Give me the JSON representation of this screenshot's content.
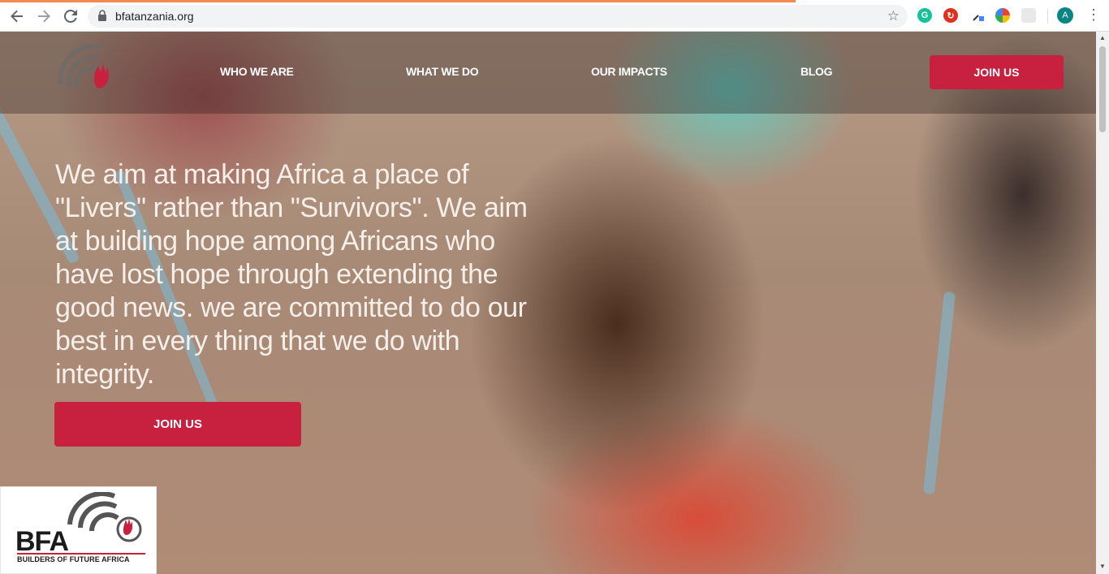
{
  "browser": {
    "url": "bfatanzania.org",
    "profile_initial": "A",
    "icons": [
      "back-icon",
      "forward-icon",
      "reload-icon",
      "lock-icon",
      "star-icon",
      "grammarly-icon",
      "extension-red-icon",
      "eyedropper-icon",
      "extension-chrome-icon",
      "extension-gray-icon",
      "more-vert-icon"
    ]
  },
  "site": {
    "nav": {
      "who_we_are": "WHO WE ARE",
      "what_we_do": "WHAT WE DO",
      "our_impacts": "OUR IMPACTS",
      "blog": "BLOG",
      "join_us": "JOIN US"
    },
    "hero": {
      "text": "We aim at making Africa a place of \"Livers\" rather than \"Survivors\". We aim at building hope among Africans who have lost hope through extending the good news. we are committed to do our best in every thing that we do with integrity.",
      "button": "JOIN US"
    },
    "badge": {
      "short": "BFA",
      "full": "BUILDERS OF FUTURE AFRICA"
    }
  },
  "colors": {
    "accent": "#c8203f",
    "omnibox": "#f1f3f4",
    "load_bar": "#f28b50"
  }
}
